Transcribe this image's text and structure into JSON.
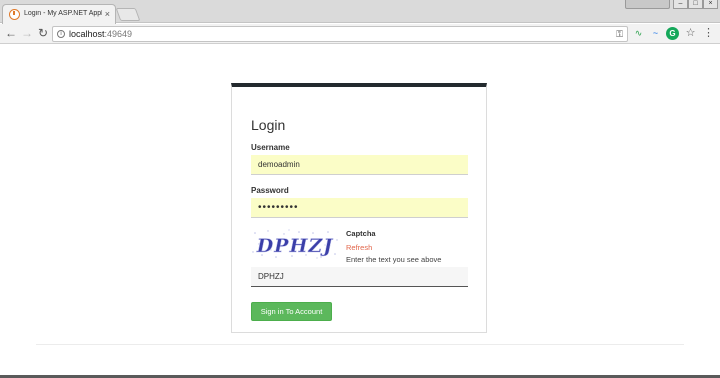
{
  "browser": {
    "tab_title": "Login - My ASP.NET Applic",
    "tab_close": "×",
    "url_host": "localhost",
    "url_port": ":49649"
  },
  "login": {
    "title": "Login",
    "username_label": "Username",
    "username_value": "demoadmin",
    "password_label": "Password",
    "password_value": "demoadmin",
    "captcha_label": "Captcha",
    "captcha_image_text": "DPHZJ",
    "refresh_link": "Refresh",
    "captcha_help": "Enter the text you see above",
    "captcha_value": "DPHZJ",
    "submit_label": "Sign in To Account"
  },
  "colors": {
    "accent_bar": "#232a2e",
    "button": "#5cb85c",
    "autofill": "#fbfdc7",
    "refresh_link": "#e2664b",
    "captcha_ink": "#3b3fa8"
  },
  "icons": [
    "favicon-icon",
    "close-icon",
    "back-icon",
    "forward-icon",
    "reload-icon",
    "info-icon",
    "key-icon",
    "extension-icon",
    "grammarly-icon",
    "star-icon",
    "menu-icon"
  ]
}
